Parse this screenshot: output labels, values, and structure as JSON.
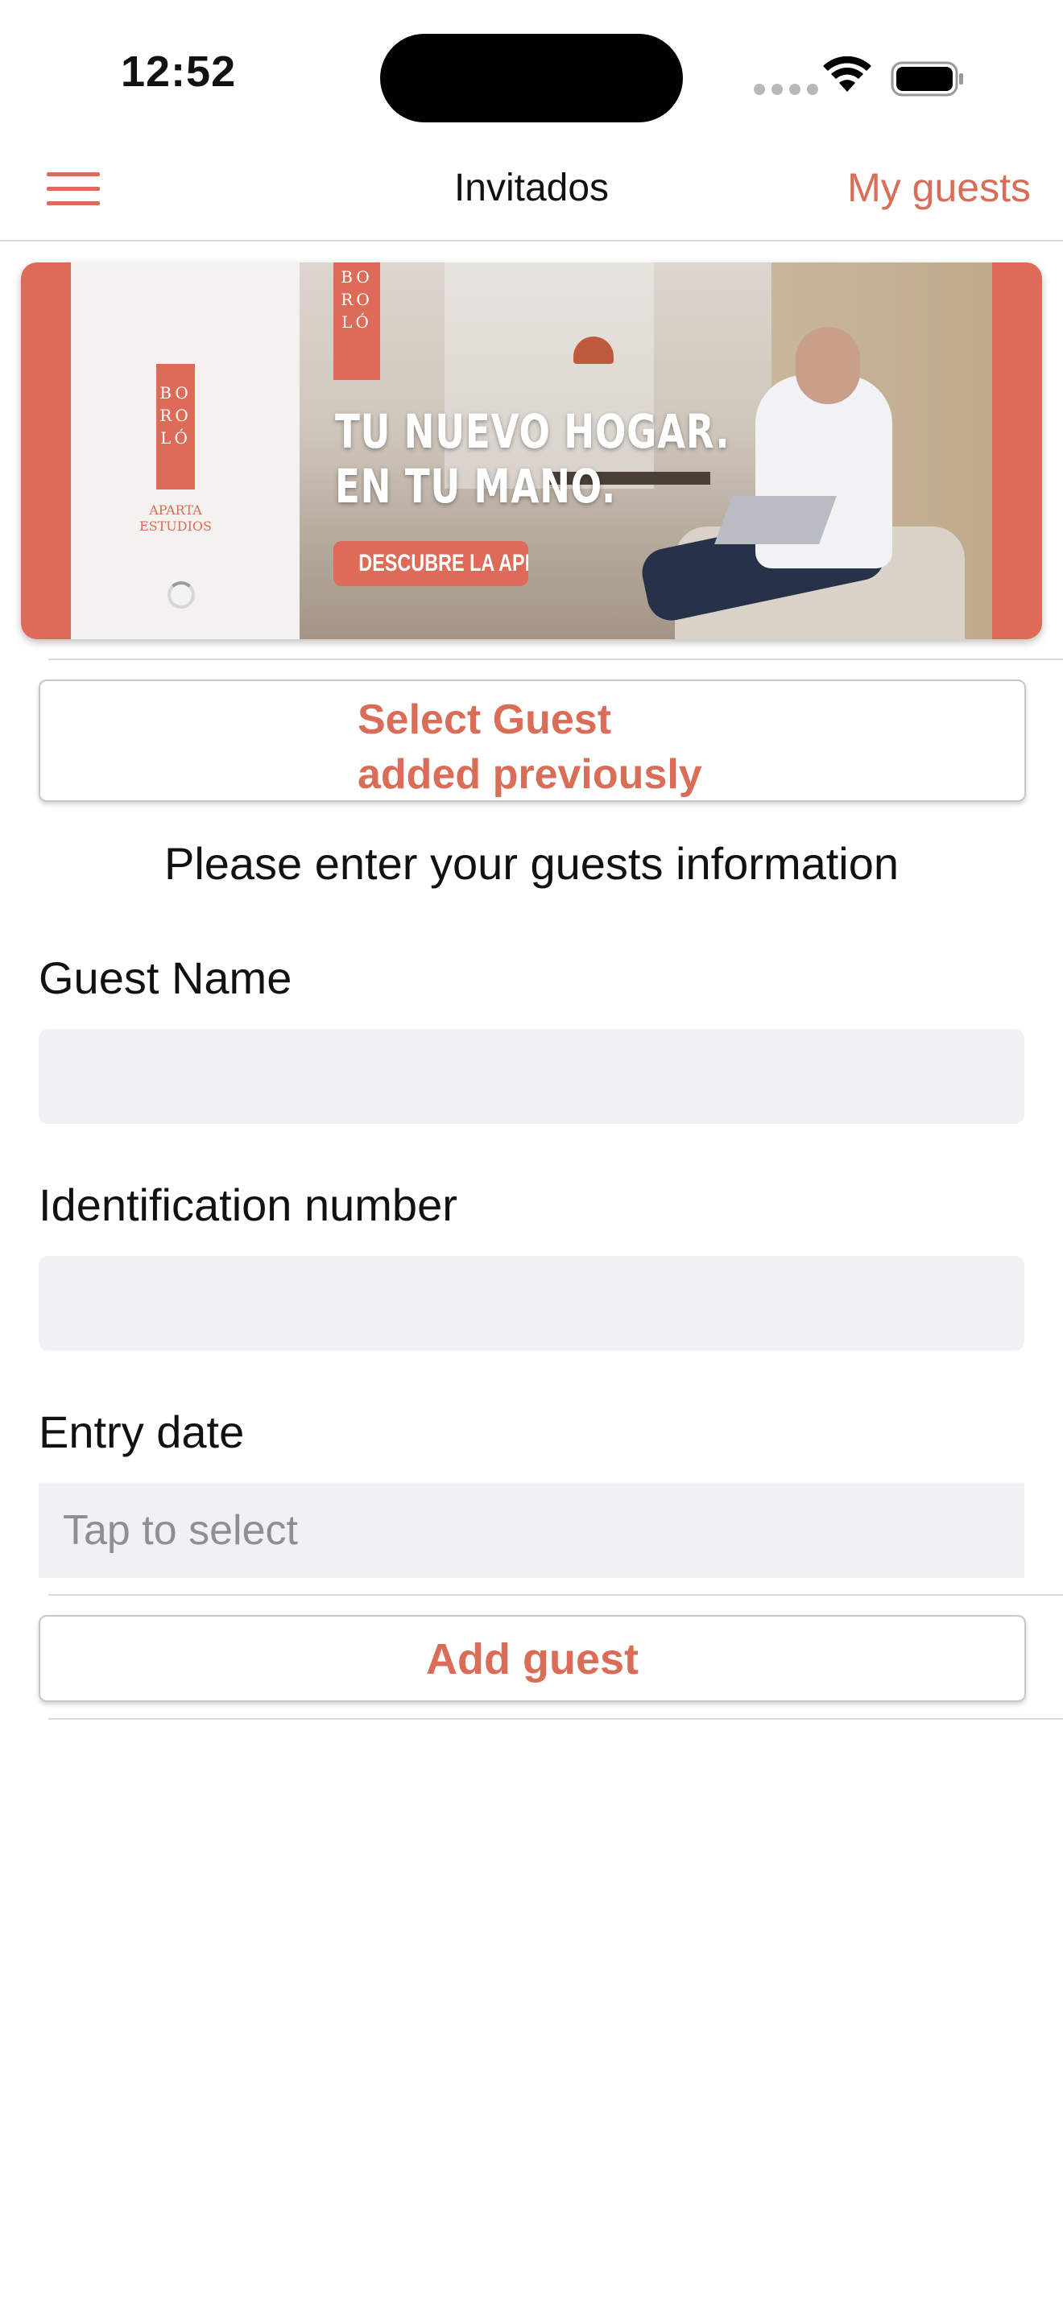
{
  "status_bar": {
    "time": "12:52"
  },
  "nav": {
    "menu_icon": "hamburger-icon",
    "title": "Invitados",
    "right_action": "My guests"
  },
  "banner": {
    "logo_letters": [
      "BO",
      "RO",
      "LÓ"
    ],
    "logo_subtitle": [
      "APARTA",
      "ESTUDIOS"
    ],
    "headline": [
      "TU NUEVO HOGAR.",
      "EN TU MANO."
    ],
    "cta": "DESCUBRE LA APP"
  },
  "select_guest_button": {
    "line1": "Select Guest",
    "line2": "added previously"
  },
  "prompt": "Please enter your guests information",
  "form": {
    "guest_name_label": "Guest Name",
    "guest_name_value": "",
    "id_label": "Identification number",
    "id_value": "",
    "entry_date_label": "Entry date",
    "entry_date_placeholder": "Tap to select"
  },
  "add_guest_button": "Add guest",
  "colors": {
    "accent": "#d96d57",
    "field_bg": "#f1f1f5"
  }
}
